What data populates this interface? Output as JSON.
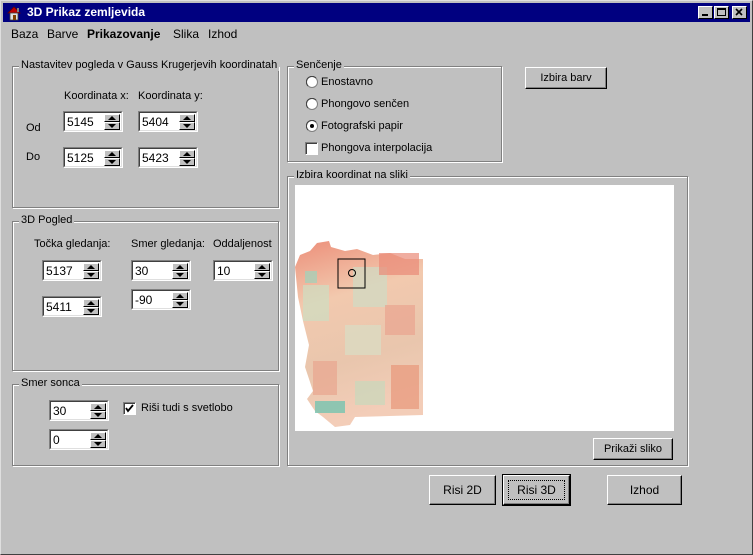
{
  "window": {
    "title": "3D Prikaz zemljevida",
    "icon": "house-icon"
  },
  "menu": {
    "items": [
      "Baza",
      "Barve",
      "Prikazovanje",
      "Slika",
      "Izhod"
    ],
    "active": "Prikazovanje"
  },
  "view_extent": {
    "title": "Nastavitev pogleda v Gauss Krugerjevih koordinatah",
    "col_x_label": "Koordinata x:",
    "col_y_label": "Koordinata y:",
    "row_from_label": "Od",
    "row_to_label": "Do",
    "from_x": "5145",
    "from_y": "5404",
    "to_x": "5125",
    "to_y": "5423"
  },
  "view3d": {
    "title": "3D Pogled",
    "eye_label": "Točka gledanja:",
    "dir_label": "Smer gledanja:",
    "dist_label": "Oddaljenost",
    "eye_x": "5137",
    "eye_y": "5411",
    "dir_1": "30",
    "dir_2": "-90",
    "distance": "10"
  },
  "sun": {
    "title": "Smer sonca",
    "value_1": "30",
    "value_2": "0",
    "light_label": "Riši tudi s svetlobo",
    "light_checked": true
  },
  "shading": {
    "title": "Senčenje",
    "options": [
      "Enostavno",
      "Phongovo senčen",
      "Fotografski papir"
    ],
    "selected": "Fotografski papir",
    "interp_label": "Phongova interpolacija",
    "interp_checked": false
  },
  "buttons": {
    "colors": "Izbira barv",
    "show_image": "Prikaži sliko",
    "draw2d": "Risi 2D",
    "draw3d": "Risi 3D",
    "exit": "Izhod"
  },
  "image_panel": {
    "title": "Izbira koordinat na sliki"
  },
  "colors": {
    "titlebar": "#000080",
    "face": "#c0c0c0",
    "terrain_high": "#ec8f7a",
    "terrain_mid": "#f2c9ae",
    "terrain_low": "#bfd8c0",
    "terrain_water": "#7cc4b0"
  }
}
